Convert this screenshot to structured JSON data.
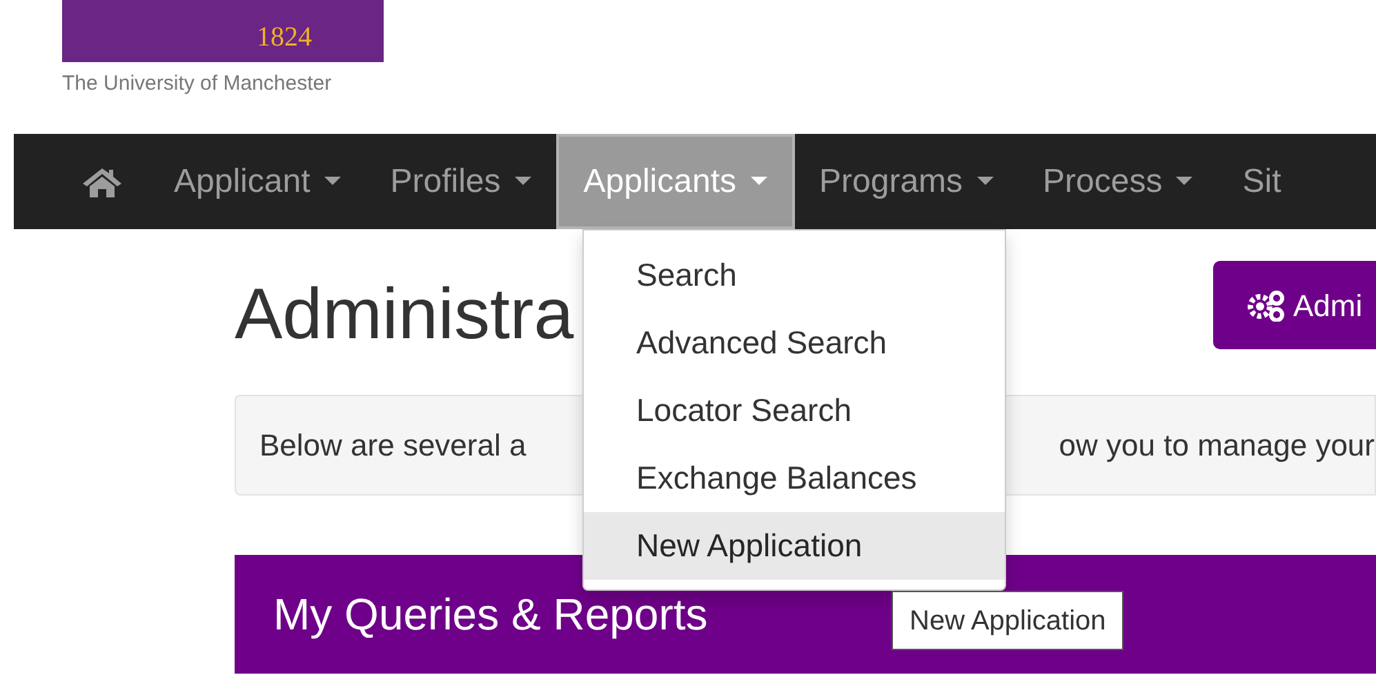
{
  "logo": {
    "year": "1824",
    "caption": "The University of Manchester"
  },
  "navbar": {
    "items": [
      {
        "label": "Applicant",
        "selected": false,
        "caret": true
      },
      {
        "label": "Profiles",
        "selected": false,
        "caret": true
      },
      {
        "label": "Applicants",
        "selected": true,
        "caret": true
      },
      {
        "label": "Programs",
        "selected": false,
        "caret": true
      },
      {
        "label": "Process",
        "selected": false,
        "caret": true
      },
      {
        "label": "Sit",
        "selected": false,
        "caret": false
      }
    ]
  },
  "dropdown": {
    "items": [
      {
        "label": "Search",
        "selected": false
      },
      {
        "label": "Advanced Search",
        "selected": false
      },
      {
        "label": "Locator Search",
        "selected": false
      },
      {
        "label": "Exchange Balances",
        "selected": false
      },
      {
        "label": "New Application",
        "selected": true
      }
    ]
  },
  "tooltip": "New Application",
  "page": {
    "heading": "Administra",
    "admin_button": "Admi",
    "intro_left": "Below are several a",
    "intro_right": "ow you to manage your",
    "panel_title": "My Queries & Reports"
  }
}
